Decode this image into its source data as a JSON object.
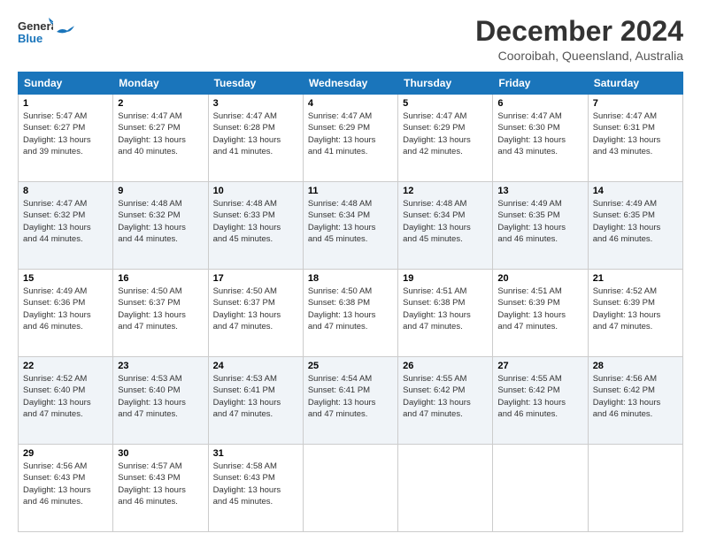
{
  "header": {
    "logo_line1": "General",
    "logo_line2": "Blue",
    "month": "December 2024",
    "location": "Cooroibah, Queensland, Australia"
  },
  "weekdays": [
    "Sunday",
    "Monday",
    "Tuesday",
    "Wednesday",
    "Thursday",
    "Friday",
    "Saturday"
  ],
  "weeks": [
    [
      {
        "day": "1",
        "sunrise": "5:47 AM",
        "sunset": "6:27 PM",
        "daylight": "13 hours and 39 minutes."
      },
      {
        "day": "2",
        "sunrise": "4:47 AM",
        "sunset": "6:27 PM",
        "daylight": "13 hours and 40 minutes."
      },
      {
        "day": "3",
        "sunrise": "4:47 AM",
        "sunset": "6:28 PM",
        "daylight": "13 hours and 41 minutes."
      },
      {
        "day": "4",
        "sunrise": "4:47 AM",
        "sunset": "6:29 PM",
        "daylight": "13 hours and 41 minutes."
      },
      {
        "day": "5",
        "sunrise": "4:47 AM",
        "sunset": "6:29 PM",
        "daylight": "13 hours and 42 minutes."
      },
      {
        "day": "6",
        "sunrise": "4:47 AM",
        "sunset": "6:30 PM",
        "daylight": "13 hours and 43 minutes."
      },
      {
        "day": "7",
        "sunrise": "4:47 AM",
        "sunset": "6:31 PM",
        "daylight": "13 hours and 43 minutes."
      }
    ],
    [
      {
        "day": "8",
        "sunrise": "4:47 AM",
        "sunset": "6:32 PM",
        "daylight": "13 hours and 44 minutes."
      },
      {
        "day": "9",
        "sunrise": "4:48 AM",
        "sunset": "6:32 PM",
        "daylight": "13 hours and 44 minutes."
      },
      {
        "day": "10",
        "sunrise": "4:48 AM",
        "sunset": "6:33 PM",
        "daylight": "13 hours and 45 minutes."
      },
      {
        "day": "11",
        "sunrise": "4:48 AM",
        "sunset": "6:34 PM",
        "daylight": "13 hours and 45 minutes."
      },
      {
        "day": "12",
        "sunrise": "4:48 AM",
        "sunset": "6:34 PM",
        "daylight": "13 hours and 45 minutes."
      },
      {
        "day": "13",
        "sunrise": "4:49 AM",
        "sunset": "6:35 PM",
        "daylight": "13 hours and 46 minutes."
      },
      {
        "day": "14",
        "sunrise": "4:49 AM",
        "sunset": "6:35 PM",
        "daylight": "13 hours and 46 minutes."
      }
    ],
    [
      {
        "day": "15",
        "sunrise": "4:49 AM",
        "sunset": "6:36 PM",
        "daylight": "13 hours and 46 minutes."
      },
      {
        "day": "16",
        "sunrise": "4:50 AM",
        "sunset": "6:37 PM",
        "daylight": "13 hours and 47 minutes."
      },
      {
        "day": "17",
        "sunrise": "4:50 AM",
        "sunset": "6:37 PM",
        "daylight": "13 hours and 47 minutes."
      },
      {
        "day": "18",
        "sunrise": "4:50 AM",
        "sunset": "6:38 PM",
        "daylight": "13 hours and 47 minutes."
      },
      {
        "day": "19",
        "sunrise": "4:51 AM",
        "sunset": "6:38 PM",
        "daylight": "13 hours and 47 minutes."
      },
      {
        "day": "20",
        "sunrise": "4:51 AM",
        "sunset": "6:39 PM",
        "daylight": "13 hours and 47 minutes."
      },
      {
        "day": "21",
        "sunrise": "4:52 AM",
        "sunset": "6:39 PM",
        "daylight": "13 hours and 47 minutes."
      }
    ],
    [
      {
        "day": "22",
        "sunrise": "4:52 AM",
        "sunset": "6:40 PM",
        "daylight": "13 hours and 47 minutes."
      },
      {
        "day": "23",
        "sunrise": "4:53 AM",
        "sunset": "6:40 PM",
        "daylight": "13 hours and 47 minutes."
      },
      {
        "day": "24",
        "sunrise": "4:53 AM",
        "sunset": "6:41 PM",
        "daylight": "13 hours and 47 minutes."
      },
      {
        "day": "25",
        "sunrise": "4:54 AM",
        "sunset": "6:41 PM",
        "daylight": "13 hours and 47 minutes."
      },
      {
        "day": "26",
        "sunrise": "4:55 AM",
        "sunset": "6:42 PM",
        "daylight": "13 hours and 47 minutes."
      },
      {
        "day": "27",
        "sunrise": "4:55 AM",
        "sunset": "6:42 PM",
        "daylight": "13 hours and 46 minutes."
      },
      {
        "day": "28",
        "sunrise": "4:56 AM",
        "sunset": "6:42 PM",
        "daylight": "13 hours and 46 minutes."
      }
    ],
    [
      {
        "day": "29",
        "sunrise": "4:56 AM",
        "sunset": "6:43 PM",
        "daylight": "13 hours and 46 minutes."
      },
      {
        "day": "30",
        "sunrise": "4:57 AM",
        "sunset": "6:43 PM",
        "daylight": "13 hours and 46 minutes."
      },
      {
        "day": "31",
        "sunrise": "4:58 AM",
        "sunset": "6:43 PM",
        "daylight": "13 hours and 45 minutes."
      },
      null,
      null,
      null,
      null
    ]
  ]
}
